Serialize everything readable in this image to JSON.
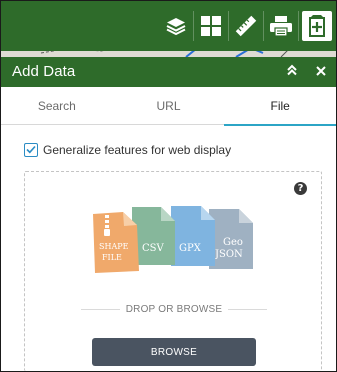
{
  "toolbar": {
    "icons": [
      "layers-icon",
      "basemap-gallery-icon",
      "measure-icon",
      "print-icon",
      "add-data-icon"
    ],
    "color": "#2e6b2a"
  },
  "panel": {
    "title": "Add Data",
    "collapse_icon": "chevron-double-up-icon",
    "close_icon": "close-icon"
  },
  "tabs": [
    {
      "label": "Search",
      "active": false
    },
    {
      "label": "URL",
      "active": false
    },
    {
      "label": "File",
      "active": true
    }
  ],
  "options": {
    "generalize_label": "Generalize features for web display",
    "generalize_checked": true
  },
  "drop_zone": {
    "help_icon": "question-circle-icon",
    "file_types": [
      {
        "line1": "SHAPE",
        "line2": "FILE",
        "color": "#f0a96b"
      },
      {
        "line1": "CSV",
        "line2": "",
        "color": "#86b79b"
      },
      {
        "line1": "GPX",
        "line2": "",
        "color": "#7fb4e0"
      },
      {
        "line1": "Geo",
        "line2": "JSON",
        "color": "#9fb1c2"
      }
    ],
    "separator_text": "DROP OR BROWSE",
    "browse_label": "BROWSE"
  },
  "colors": {
    "accent": "#2ca5c6",
    "checkbox": "#2b8cc4",
    "button": "#4a5461"
  }
}
